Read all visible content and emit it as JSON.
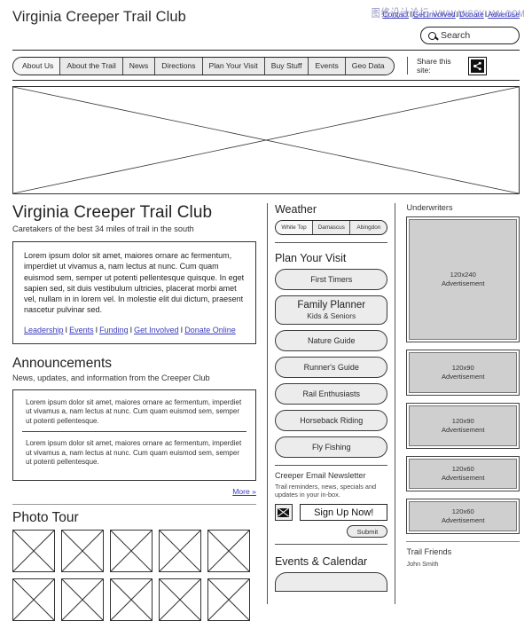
{
  "header": {
    "site_title": "Virginia Creeper Trail Club",
    "top_links": [
      {
        "label": "Contact"
      },
      {
        "label": "Get Involved"
      },
      {
        "label": "Donate"
      },
      {
        "label": "Advertise"
      }
    ],
    "separator": "I",
    "watermark_cn": "图络设计论坛",
    "watermark_url": "WWW.MISSYUAN.COM",
    "search": {
      "placeholder": "Search",
      "value": "",
      "icon": "search-icon"
    }
  },
  "nav": {
    "tabs": [
      {
        "label": "About Us"
      },
      {
        "label": "About the Trail"
      },
      {
        "label": "News"
      },
      {
        "label": "Directions"
      },
      {
        "label": "Plan Your Visit"
      },
      {
        "label": "Buy Stuff"
      },
      {
        "label": "Events"
      },
      {
        "label": "Geo Data"
      }
    ],
    "share_label": "Share this site:",
    "share_icon": "share-icon",
    "share_glyph": "❮"
  },
  "hero": {
    "name": "hero-image-placeholder"
  },
  "main": {
    "title": "Virginia Creeper Trail Club",
    "subtitle": "Caretakers of the best 34 miles of trail in the south",
    "intro_body": "Lorem ipsum dolor sit amet, maiores ornare ac fermentum, imperdiet ut vivamus a, nam lectus at nunc. Cum quam euismod sem, semper ut potenti pellentesque quisque. In eget sapien sed, sit duis vestibulum ultricies, placerat morbi amet vel, nullam in in lorem vel. In molestie elit dui dictum, praesent nascetur pulvinar sed.",
    "intro_links": [
      {
        "label": "Leadership"
      },
      {
        "label": "Events"
      },
      {
        "label": "Funding"
      },
      {
        "label": "Get Involved"
      },
      {
        "label": "Donate Online"
      }
    ],
    "announcements": {
      "title": "Announcements",
      "subtitle": "News, updates, and information from the Creeper Club",
      "items": [
        {
          "text": "Lorem ipsum dolor sit amet, maiores ornare ac fermentum, imperdiet ut vivamus a, nam lectus at nunc. Cum quam euismod sem, semper ut potenti pellentesque."
        },
        {
          "text": "Lorem ipsum dolor sit amet, maiores ornare ac fermentum, imperdiet ut vivamus a, nam lectus at nunc. Cum quam euismod sem, semper ut potenti pellentesque."
        }
      ],
      "more_label": "More »"
    },
    "photo_tour": {
      "title": "Photo Tour",
      "thumb_count_row1": 5,
      "thumb_count_row2": 5
    }
  },
  "middle": {
    "weather": {
      "title": "Weather",
      "tabs": [
        {
          "label": "White Top"
        },
        {
          "label": "Damascus"
        },
        {
          "label": "Abingdon"
        }
      ]
    },
    "plan_visit": {
      "title": "Plan Your Visit",
      "items": [
        {
          "label": "First Timers",
          "sub": "",
          "featured": false
        },
        {
          "label": "Family Planner",
          "sub": "Kids & Seniors",
          "featured": true
        },
        {
          "label": "Nature Guide",
          "sub": "",
          "featured": false
        },
        {
          "label": "Runner's Guide",
          "sub": "",
          "featured": false
        },
        {
          "label": "Rail Enthusiasts",
          "sub": "",
          "featured": false
        },
        {
          "label": "Horseback Riding",
          "sub": "",
          "featured": false
        },
        {
          "label": "Fly Fishing",
          "sub": "",
          "featured": false
        }
      ]
    },
    "newsletter": {
      "title": "Creeper Email Newsletter",
      "subtitle": "Trail reminders, news, specials and updates in your in-box.",
      "mail_icon": "envelope-icon",
      "signup_label": "Sign Up Now!",
      "submit_label": "Submit"
    },
    "events": {
      "title": "Events & Calendar"
    }
  },
  "right": {
    "underwriters_title": "Underwriters",
    "ads": [
      {
        "size": "120x240",
        "caption": "Advertisement",
        "class": "ad-240"
      },
      {
        "size": "120x90",
        "caption": "Advertisement",
        "class": "ad-90"
      },
      {
        "size": "120x90",
        "caption": "Advertisement",
        "class": "ad-90"
      },
      {
        "size": "120x60",
        "caption": "Advertisement",
        "class": "ad-60"
      },
      {
        "size": "120x60",
        "caption": "Advertisement",
        "class": "ad-60"
      }
    ],
    "trail_friends": {
      "title": "Trail Friends",
      "names": [
        {
          "label": "John Smith"
        }
      ]
    }
  },
  "colors": {
    "link": "#3b3bc0",
    "border": "#333333",
    "button_fill": "#ececec",
    "ad_fill": "#cfcfcf"
  }
}
